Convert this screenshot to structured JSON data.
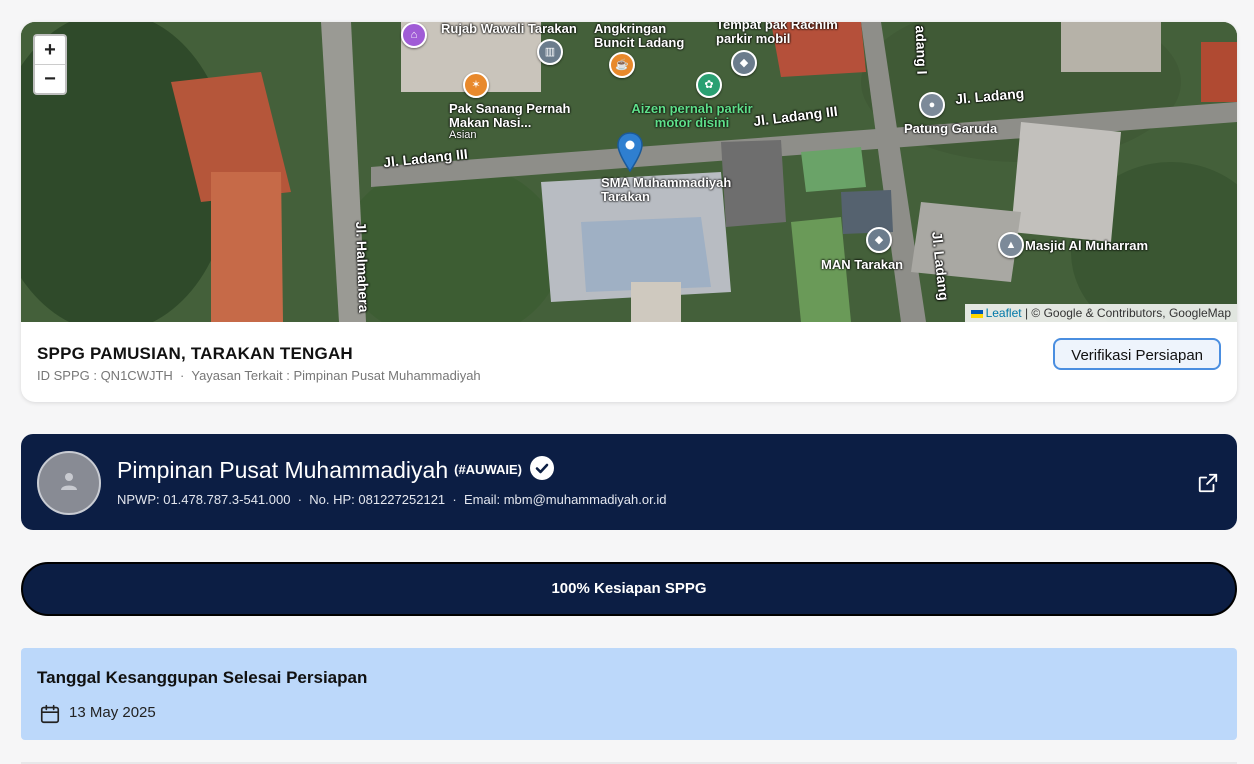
{
  "map": {
    "zoom_in": "+",
    "zoom_out": "−",
    "attribution_leaflet": "Leaflet",
    "attribution_rest": "| © Google & Contributors, GoogleMap",
    "labels": {
      "rujab": "Rujab Wawali Tarakan",
      "angkringan": "Angkringan Buncit Ladang",
      "tempat_rachim": "Tempat pak Rachim parkir mobil",
      "pak_sanang": "Pak Sanang Pernah Makan Nasi...",
      "asian": "Asian",
      "aizen": "Aizen pernah parkir motor disini",
      "patung": "Patung Garuda",
      "sma": "SMA Muhammadiyah Tarakan",
      "man": "MAN Tarakan",
      "masjid": "Masjid Al Muharram"
    },
    "streets": {
      "ladang3_left": "Jl. Ladang III",
      "ladang3_right": "Jl. Ladang III",
      "ladang_right": "Jl. Ladang",
      "halmahera": "Jl. Halmahera",
      "ladang_vertical": "Jl. Ladang",
      "ladang_top": "adang I"
    }
  },
  "sppg": {
    "title": "SPPG PAMUSIAN, TARAKAN TENGAH",
    "id_label": "ID SPPG : QN1CWJTH",
    "separator": "·",
    "yayasan_label": "Yayasan Terkait : Pimpinan Pusat Muhammadiyah",
    "verify_button": "Verifikasi Persiapan"
  },
  "org": {
    "name": "Pimpinan Pusat Muhammadiyah",
    "code": "(#AUWAIE)",
    "npwp": "NPWP: 01.478.787.3-541.000",
    "phone": "No. HP: 081227252121",
    "email": "Email: mbm@muhammadiyah.or.id",
    "separator": "·"
  },
  "readiness": {
    "label": "100% Kesiapan SPPG"
  },
  "completion": {
    "title": "Tanggal Kesanggupan Selesai Persiapan",
    "date": "13 May 2025"
  },
  "colors": {
    "navy": "#0c1e44",
    "accent_blue": "#4a8ee0",
    "date_card": "#bcd8fa"
  }
}
